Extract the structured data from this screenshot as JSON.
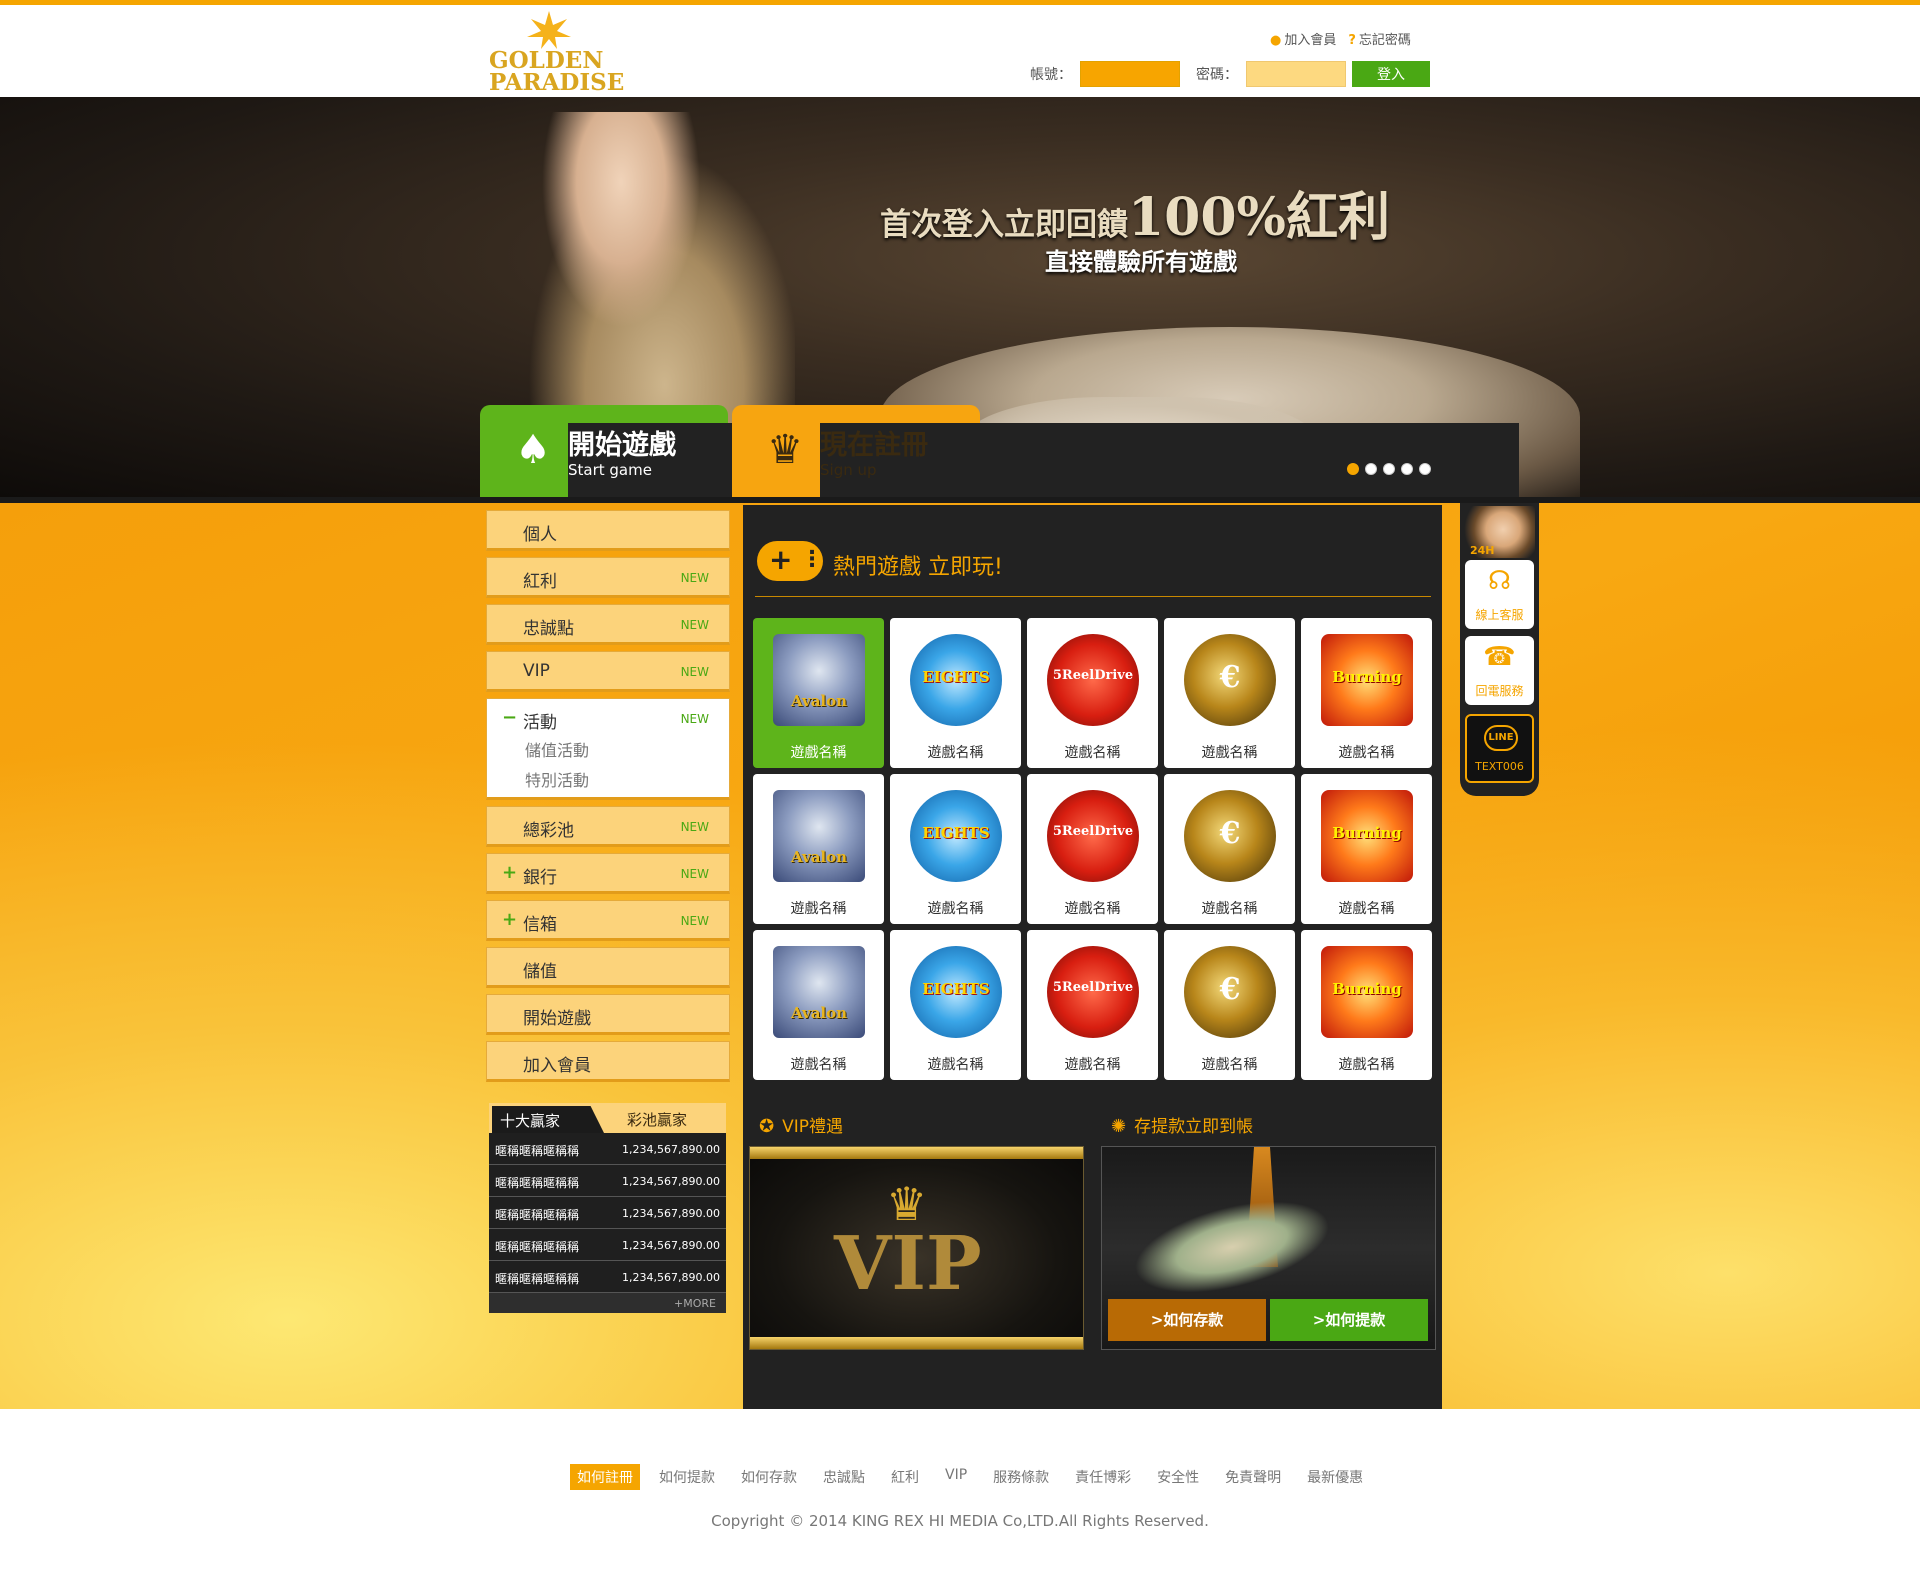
{
  "header": {
    "logo_line1": "GOLDEN",
    "logo_line2": "PARADISE",
    "join_label": "加入會員",
    "forgot_label": "忘記密碼",
    "account_label": "帳號：",
    "password_label": "密碼：",
    "login_label": "登入"
  },
  "banner": {
    "headline_small": "首次登入立即回饋",
    "headline_big": "100%紅利",
    "subline": "直接體驗所有遊戲",
    "start_main": "開始遊戲",
    "start_en": "Start game",
    "signup_main": "現在註冊",
    "signup_en": "Sign up",
    "slide_count": 5,
    "active_slide": 1
  },
  "sidebar": {
    "items": [
      {
        "label": "個人",
        "new": ""
      },
      {
        "label": "紅利",
        "new": "NEW"
      },
      {
        "label": "忠誠點",
        "new": "NEW"
      },
      {
        "label": "VIP",
        "new": "NEW"
      },
      {
        "label": "活動",
        "new": "NEW",
        "toggle": "−",
        "subitems": [
          "儲值活動",
          "特別活動"
        ]
      },
      {
        "label": "總彩池",
        "new": "NEW"
      },
      {
        "label": "銀行",
        "new": "NEW",
        "toggle": "+"
      },
      {
        "label": "信箱",
        "new": "NEW",
        "toggle": "+"
      },
      {
        "label": "儲值",
        "new": ""
      },
      {
        "label": "開始遊戲",
        "new": ""
      },
      {
        "label": "加入會員",
        "new": ""
      }
    ]
  },
  "winners": {
    "tab_active": "十大贏家",
    "tab_inactive": "彩池贏家",
    "rows": [
      {
        "name": "暱稱暱稱暱稱稱",
        "amount": "1,234,567,890.00"
      },
      {
        "name": "暱稱暱稱暱稱稱",
        "amount": "1,234,567,890.00"
      },
      {
        "name": "暱稱暱稱暱稱稱",
        "amount": "1,234,567,890.00"
      },
      {
        "name": "暱稱暱稱暱稱稱",
        "amount": "1,234,567,890.00"
      },
      {
        "name": "暱稱暱稱暱稱稱",
        "amount": "1,234,567,890.00"
      }
    ],
    "more_label": "+MORE"
  },
  "games": {
    "title": "熱門遊戲 立即玩!",
    "card_label": "遊戲名稱",
    "art_text": [
      "Avalon",
      "EIGHTS",
      "5ReelDrive",
      "€",
      "Burning"
    ],
    "art_class": [
      "art-avalon",
      "art-eights",
      "art-5reel",
      "art-euro",
      "art-burning"
    ],
    "rows": 3,
    "active_index": 0
  },
  "promo": {
    "vip_title": "VIP禮遇",
    "vip_text": "VIP",
    "bank_title": "存提款立即到帳",
    "deposit_label": ">如何存款",
    "withdraw_label": ">如何提款"
  },
  "float_panel": {
    "hours": "24H",
    "service_label": "線上客服",
    "callback_label": "回電服務",
    "line_logo": "LINE",
    "line_id": "TEXT006"
  },
  "footer": {
    "links": [
      "如何註冊",
      "如何提款",
      "如何存款",
      "忠誠點",
      "紅利",
      "VIP",
      "服務條款",
      "責任博彩",
      "安全性",
      "免責聲明",
      "最新優惠"
    ],
    "active_link": 0,
    "copyright": "Copyright © 2014 KING REX HI MEDIA Co,LTD.All Rights Reserved."
  },
  "colors": {
    "accent": "#f5a500",
    "green": "#5eb41b",
    "dark": "#222222"
  }
}
